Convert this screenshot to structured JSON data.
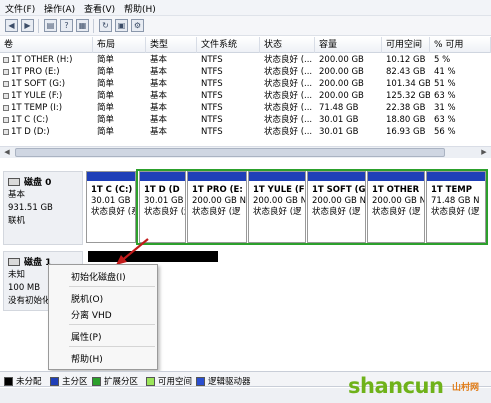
{
  "menubar": {
    "items": [
      "文件(F)",
      "操作(A)",
      "查看(V)",
      "帮助(H)"
    ]
  },
  "toolbar": {
    "buttons": [
      "back-icon",
      "forward-icon",
      "list-view-icon",
      "help-icon",
      "properties-icon",
      "refresh-icon",
      "rescan-icon",
      "settings-icon"
    ]
  },
  "volume_table": {
    "columns": [
      "卷",
      "布局",
      "类型",
      "文件系统",
      "状态",
      "容量",
      "可用空间",
      "% 可用"
    ],
    "rows": [
      [
        "1T OTHER (H:)",
        "简单",
        "基本",
        "NTFS",
        "状态良好 (...",
        "200.00 GB",
        "10.12 GB",
        "5 %"
      ],
      [
        "1T PRO (E:)",
        "简单",
        "基本",
        "NTFS",
        "状态良好 (...",
        "200.00 GB",
        "82.43 GB",
        "41 %"
      ],
      [
        "1T SOFT (G:)",
        "简单",
        "基本",
        "NTFS",
        "状态良好 (...",
        "200.00 GB",
        "101.34 GB",
        "51 %"
      ],
      [
        "1T YULE (F:)",
        "简单",
        "基本",
        "NTFS",
        "状态良好 (...",
        "200.00 GB",
        "125.32 GB",
        "63 %"
      ],
      [
        "1T TEMP (I:)",
        "简单",
        "基本",
        "NTFS",
        "状态良好 (...",
        "71.48 GB",
        "22.38 GB",
        "31 %"
      ],
      [
        "1T C (C:)",
        "简单",
        "基本",
        "NTFS",
        "状态良好 (...",
        "30.01 GB",
        "18.80 GB",
        "63 %"
      ],
      [
        "1T D (D:)",
        "简单",
        "基本",
        "NTFS",
        "状态良好 (...",
        "30.01 GB",
        "16.93 GB",
        "56 %"
      ]
    ]
  },
  "disk0": {
    "title": "磁盘 0",
    "type": "基本",
    "size": "931.51 GB",
    "status": "联机",
    "partitions": [
      {
        "name": "1T C (C:)",
        "size": "30.01 GB",
        "status": "状态良好 (系"
      },
      {
        "name": "1T D (D",
        "size": "30.01 GB",
        "status": "状态良好 (逻"
      },
      {
        "name": "1T PRO (E:",
        "size": "200.00 GB N",
        "status": "状态良好 (逻"
      },
      {
        "name": "1T YULE (F",
        "size": "200.00 GB N",
        "status": "状态良好 (逻"
      },
      {
        "name": "1T SOFT (G",
        "size": "200.00 GB N",
        "status": "状态良好 (逻"
      },
      {
        "name": "1T OTHER",
        "size": "200.00 GB N",
        "status": "状态良好 (逻"
      },
      {
        "name": "1T TEMP",
        "size": "71.48 GB N",
        "status": "状态良好 (逻"
      }
    ]
  },
  "disk1": {
    "title": "磁盘 1",
    "type": "未知",
    "size": "100 MB",
    "status": "没有初始化"
  },
  "context_menu": {
    "init": "初始化磁盘(I)",
    "offline": "脱机(O)",
    "detach": "分离 VHD",
    "properties": "属性(P)",
    "help": "帮助(H)"
  },
  "legend": [
    {
      "label": "未分配",
      "color": "#000000"
    },
    {
      "label": "主分区",
      "color": "#1f3fb8"
    },
    {
      "label": "扩展分区",
      "color": "#2ca02c"
    },
    {
      "label": "可用空间",
      "color": "#9be55a"
    },
    {
      "label": "逻辑驱动器",
      "color": "#2b4fd0"
    }
  ],
  "watermark": {
    "text": "shancun",
    "suffix": "山村网"
  },
  "colors": {
    "primary_partition": "#1f3fb8",
    "extended_partition": "#2ca02c",
    "unallocated": "#000000"
  }
}
